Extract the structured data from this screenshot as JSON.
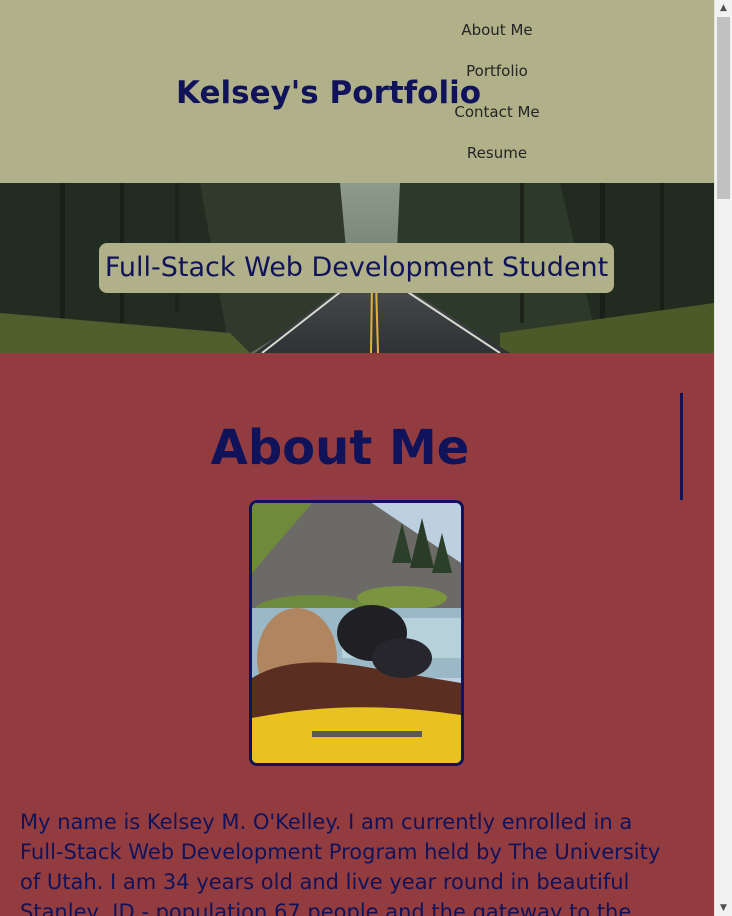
{
  "header": {
    "title": "Kelsey's Portfolio",
    "nav": [
      "About Me",
      "Portfolio",
      "Contact Me",
      "Resume"
    ]
  },
  "hero": {
    "subtitle": "Full-Stack Web Development Student"
  },
  "about": {
    "heading": "About Me",
    "bio": "My name is Kelsey M. O'Kelley. I am currently enrolled in a Full-Stack Web Development Program held by The University of Utah. I am 34 years old and live year round in beautiful Stanley, ID - population 67 people and the gateway to the wild and scenic Frank"
  },
  "colors": {
    "header_bg": "#b0b089",
    "main_bg": "#933c40",
    "accent_navy": "#10135a"
  },
  "icons": {
    "scroll_up": "triangle-up",
    "scroll_down": "triangle-down"
  }
}
